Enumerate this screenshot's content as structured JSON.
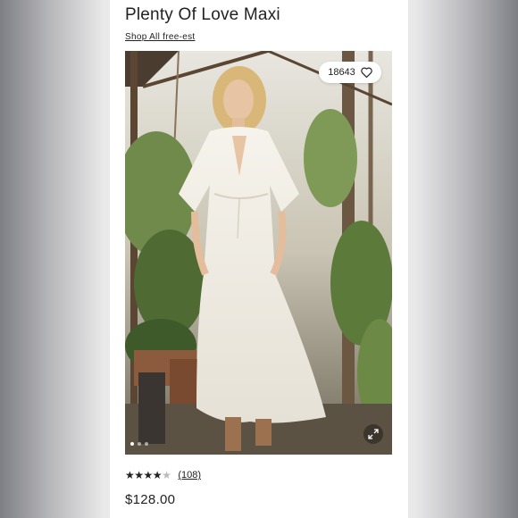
{
  "product": {
    "title": "Plenty Of Love Maxi",
    "shop_link": "Shop All free-est",
    "likes": "18643",
    "rating_stars": 4,
    "rating_max": 5,
    "reviews": "(108)",
    "price": "$128.00"
  },
  "gallery": {
    "image_count": 3,
    "active_index": 0
  },
  "icons": {
    "like": "heart-icon",
    "expand": "expand-icon"
  }
}
